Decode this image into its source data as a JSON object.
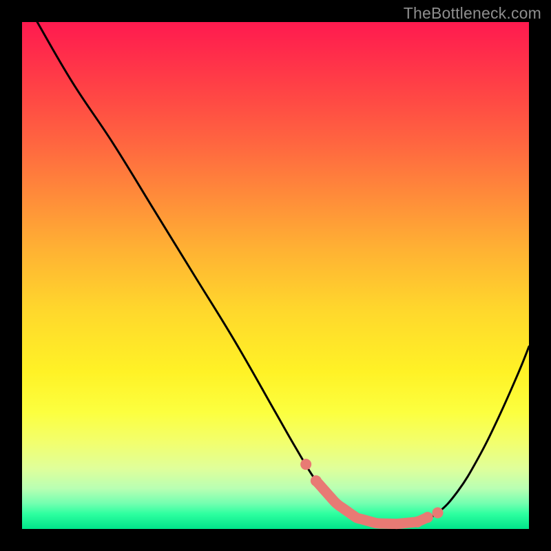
{
  "watermark": "TheBottleneck.com",
  "colors": {
    "line": "#000000",
    "highlight_stroke": "#e87a74",
    "highlight_dot": "#e87a74",
    "frame_bg": "#000000"
  },
  "chart_data": {
    "type": "line",
    "title": "",
    "xlabel": "",
    "ylabel": "",
    "xlim": [
      0,
      100
    ],
    "ylim": [
      0,
      100
    ],
    "grid": false,
    "legend": false,
    "series": [
      {
        "name": "bottleneck-curve",
        "x": [
          3,
          10,
          18,
          26,
          34,
          42,
          50,
          54,
          58,
          62,
          66,
          70,
          74,
          78,
          82,
          86,
          90,
          94,
          98,
          100
        ],
        "y": [
          100,
          88,
          76,
          63,
          50,
          37,
          23,
          16,
          9.5,
          5,
          2.2,
          1.1,
          1.0,
          1.4,
          3.2,
          7.5,
          14,
          22,
          31,
          36
        ]
      }
    ],
    "highlight": {
      "segment_x": [
        58,
        80
      ],
      "dots_x": [
        56,
        58,
        78,
        80,
        82
      ]
    }
  }
}
